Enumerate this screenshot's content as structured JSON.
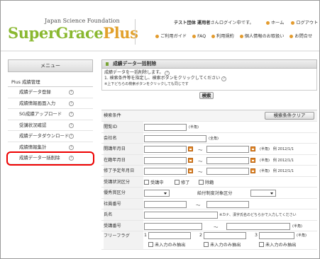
{
  "header": {
    "org_name": "Japan Science Foundation",
    "logo_main": "SuperGrace",
    "logo_plus": "Plus",
    "user_org": "テスト団体",
    "user_name": "運用者",
    "user_suffix": "さんログイン中です。",
    "top_links": [
      "ホーム",
      "ログアウト"
    ],
    "sub_links": [
      "ご利用ガイド",
      "FAQ",
      "利用規約",
      "個人情報のお取扱い",
      "お問合せ"
    ]
  },
  "sidebar": {
    "menu_label": "メニュー",
    "category": "Plus 成績管理",
    "items": [
      {
        "label": "成績データ登録"
      },
      {
        "label": "成績情報画面入力"
      },
      {
        "label": "SG成績アップロード"
      },
      {
        "label": "受講状況確認"
      },
      {
        "label": "成績データダウンロード"
      },
      {
        "label": "成績情報集計"
      },
      {
        "label": "成績データ一括削除",
        "active": true
      }
    ],
    "help_glyph": "?"
  },
  "main": {
    "title": "成績データ一括削除",
    "desc_line1": "成績データを一括削除します。",
    "desc_line2": "1. 検索条件等を指定し、検索ボタンをクリックしてください",
    "desc_line3": "※上下どちらの検索ボタンをクリックしても同じです",
    "search_button": "検索",
    "form": {
      "header_label": "検索条件",
      "clear_button": "検索条件クリア",
      "rows": {
        "etsuran_id": {
          "label": "閲覧ID",
          "note": "(半角)"
        },
        "company": {
          "label": "会社名",
          "note": "(全角)"
        },
        "start_date": {
          "label": "開講年月日",
          "note": "(半角)　例 2012/1/1"
        },
        "enroll_date": {
          "label": "在籍年月日",
          "note": "(半角)　例 2012/1/1"
        },
        "finish_date": {
          "label": "修了予定年月日",
          "note": "(半角)　例 2012/1/1"
        },
        "status": {
          "label": "受講状況区分",
          "options": [
            "受講中",
            "修了",
            "除籍"
          ]
        },
        "priority": {
          "label": "優秀賞区分",
          "sub_label": "給付制度対象区分"
        },
        "employee_no": {
          "label": "社員番号"
        },
        "name": {
          "label": "氏名",
          "note": "※カナ、漢字氏名のどちらかで入力してください"
        },
        "course_no": {
          "label": "受講番号",
          "note": "(半角)"
        },
        "free_flag": {
          "label": "フリーフラグ",
          "nums": [
            "1",
            "2",
            "3"
          ],
          "note": "(半角)",
          "unentered": "未入力のみ抽出"
        }
      },
      "tilde": "～"
    }
  }
}
